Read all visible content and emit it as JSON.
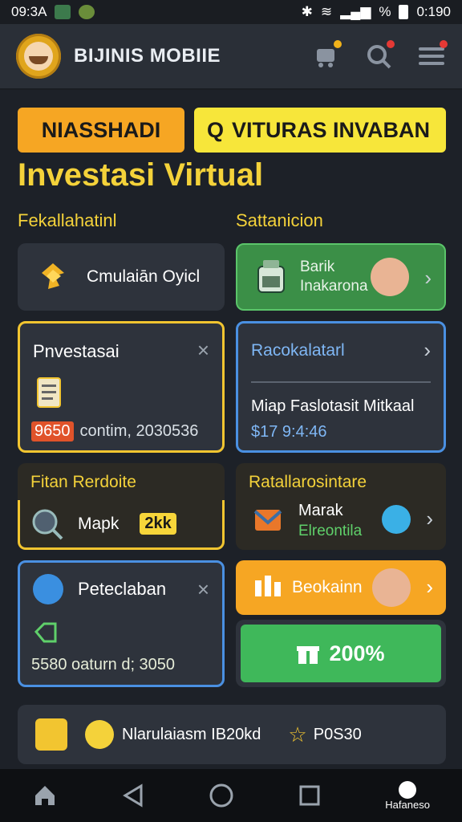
{
  "status_bar": {
    "time_left": "09:3A",
    "battery_pct": "%",
    "time_right": "0:190"
  },
  "app": {
    "title": "BIJINIS MOBIIE"
  },
  "hero": {
    "chip_left": "NIASSHADI",
    "chip_right_icon": "Q",
    "chip_right": "VITURAS INVABAN"
  },
  "heading": "Investasi Virtual",
  "section_left": "Fekallahatinl",
  "section_right": "Sattanicion",
  "cards": {
    "simulation": {
      "label": "Cmulaiān Oyicl"
    },
    "bank": {
      "line1": "Barik",
      "line2": "Inakarona"
    },
    "investasi": {
      "title": "Pnvestasai",
      "amount_badge": "9650",
      "line": "contim, 2030536"
    },
    "facebook": {
      "title": "Racokalatarl",
      "subtitle": "Miap Faslotasit Mitkaal",
      "amount": "$17 9:4:46"
    },
    "market_left": {
      "header": "Fitan Rerdoite",
      "label": "Mapk",
      "badge": "2kk"
    },
    "market_right": {
      "header": "Ratallarosintare",
      "line1": "Marak",
      "line2": "Elreontila"
    },
    "peteclaban": {
      "title": "Peteclaban",
      "line": "5580 oaturn d; 3050"
    },
    "beokainn": {
      "label": "Beokainn"
    },
    "percent": {
      "label": "200%"
    }
  },
  "footer_card": {
    "label": "Nlarulaiasm IB20kd",
    "points": "P0S30"
  },
  "bottom_nav": {
    "corner_label": "Hafaneso"
  },
  "colors": {
    "accent_yellow": "#f4d23a",
    "orange": "#f6a623",
    "green": "#3b9a4c",
    "blue": "#4a90e2"
  }
}
